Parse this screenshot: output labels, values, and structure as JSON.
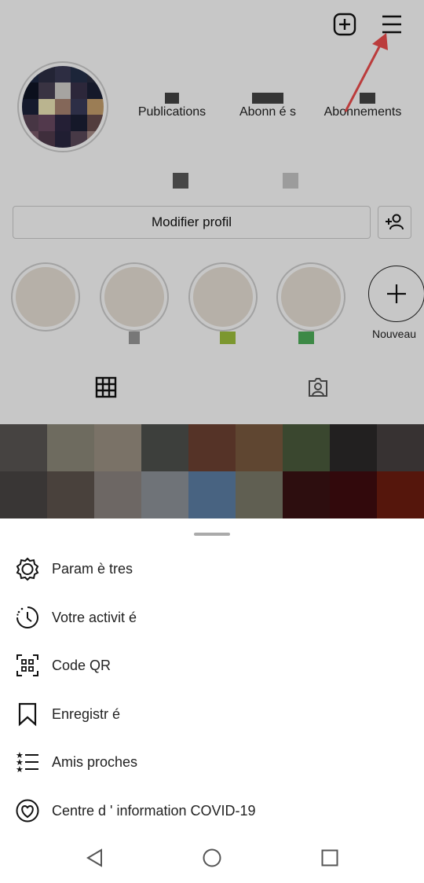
{
  "header": {
    "new_post_icon": "plus-square-icon",
    "menu_icon": "hamburger-menu-icon"
  },
  "profile": {
    "stats": [
      {
        "label": "Publications"
      },
      {
        "label": "Abonn é s"
      },
      {
        "label": "Abonnements"
      }
    ],
    "edit_profile_label": "Modifier profil",
    "new_highlight_label": "Nouveau"
  },
  "menu": {
    "items": [
      {
        "label": "Param è tres",
        "icon": "settings-gear-icon"
      },
      {
        "label": "Votre activit é",
        "icon": "activity-clock-icon"
      },
      {
        "label": "Code QR",
        "icon": "qr-code-icon"
      },
      {
        "label": "Enregistr é",
        "icon": "bookmark-icon"
      },
      {
        "label": "Amis proches",
        "icon": "close-friends-list-icon"
      },
      {
        "label": "Centre d ' information COVID-19",
        "icon": "covid-heart-icon"
      }
    ]
  },
  "colors": {
    "annotation_arrow": "#f04e4e",
    "grid_row1": [
      "#5a5654",
      "#8e8a7a",
      "#9d9384",
      "#4f514e",
      "#6e4233",
      "#7a5a3f",
      "#4b5b3d",
      "#2c2a29",
      "#474140"
    ],
    "grid_row2": [
      "#4a4644",
      "#5e544d",
      "#8c8580",
      "#8f949a",
      "#5d7fa6",
      "#7c7a6a",
      "#3a1314",
      "#410c10",
      "#6e1d10"
    ]
  }
}
